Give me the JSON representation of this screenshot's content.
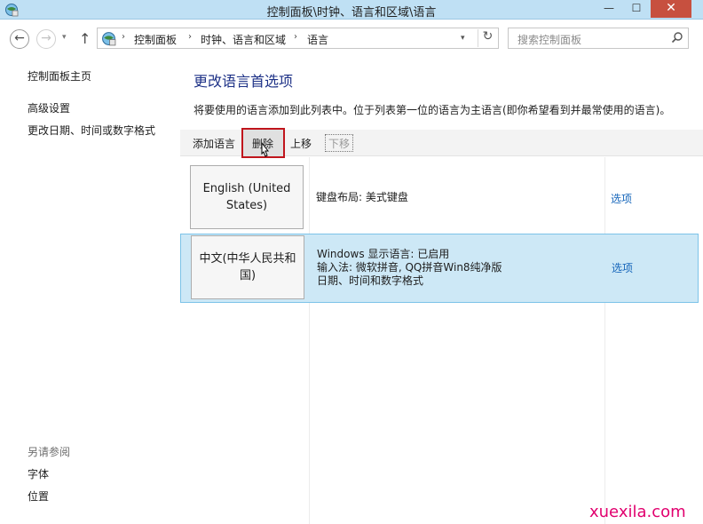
{
  "window": {
    "title": "控制面板\\时钟、语言和区域\\语言",
    "min_glyph": "—",
    "max_glyph": "☐",
    "close_glyph": "✕",
    "icon": "control-panel-icon"
  },
  "navigation": {
    "back_glyph": "←",
    "forward_glyph": "→",
    "recent_glyph": "▾",
    "up_glyph": "↑",
    "breadcrumb": [
      "控制面板",
      "时钟、语言和区域",
      "语言"
    ],
    "crumb_sep": "›",
    "address_drop_glyph": "▾",
    "refresh_glyph": "↻",
    "search_placeholder": "搜索控制面板"
  },
  "sidebar": {
    "home": "控制面板主页",
    "links": [
      "高级设置",
      "更改日期、时间或数字格式"
    ],
    "see_also_heading": "另请参阅",
    "see_also": [
      "字体",
      "位置"
    ]
  },
  "main": {
    "title": "更改语言首选项",
    "description": "将要使用的语言添加到此列表中。位于列表第一位的语言为主语言(即你希望看到并最常使用的语言)。",
    "toolbar": {
      "add": "添加语言",
      "remove": "删除",
      "move_up": "上移",
      "move_down": "下移"
    },
    "languages": [
      {
        "name": "English (United States)",
        "details": [
          "键盘布局: 美式键盘"
        ],
        "options": "选项",
        "selected": false
      },
      {
        "name": "中文(中华人民共和国)",
        "details": [
          "Windows 显示语言: 已启用",
          "输入法: 微软拼音, QQ拼音Win8纯净版",
          "日期、时间和数字格式"
        ],
        "options": "选项",
        "selected": true
      }
    ]
  },
  "watermark": "xuexila.com",
  "colors": {
    "title_bar": "#bfe0f4",
    "selected_row": "#cde8f6",
    "link": "#1565ba",
    "heading": "#1e3287",
    "highlight_box": "#c0151c",
    "watermark": "#e1006e"
  }
}
